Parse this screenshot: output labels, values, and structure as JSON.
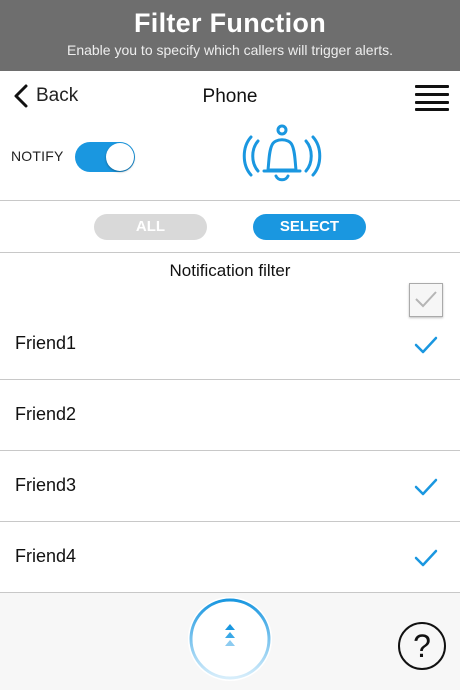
{
  "banner": {
    "title": "Filter Function",
    "subtitle": "Enable you to specify which callers will trigger alerts."
  },
  "navbar": {
    "back_label": "Back",
    "title": "Phone",
    "back_icon": "chevron-left-icon",
    "menu_icon": "hamburger-menu-icon"
  },
  "notify": {
    "label": "NOTIFY",
    "enabled": true,
    "bell_icon": "ringing-bell-icon"
  },
  "segments": {
    "all_label": "ALL",
    "select_label": "SELECT",
    "selected": "SELECT"
  },
  "filter": {
    "title": "Notification filter",
    "select_all_checked": false,
    "friends": [
      {
        "name": "Friend1",
        "checked": true
      },
      {
        "name": "Friend2",
        "checked": false
      },
      {
        "name": "Friend3",
        "checked": true
      },
      {
        "name": "Friend4",
        "checked": true
      }
    ]
  },
  "bottom": {
    "scroll_up_icon": "double-chevron-up-icon",
    "help_icon": "question-mark-icon",
    "help_glyph": "?"
  },
  "colors": {
    "accent": "#1a97e0",
    "banner": "#6e6e6e",
    "segment_inactive": "#d9d9d9",
    "divider": "#c8c8c8"
  }
}
